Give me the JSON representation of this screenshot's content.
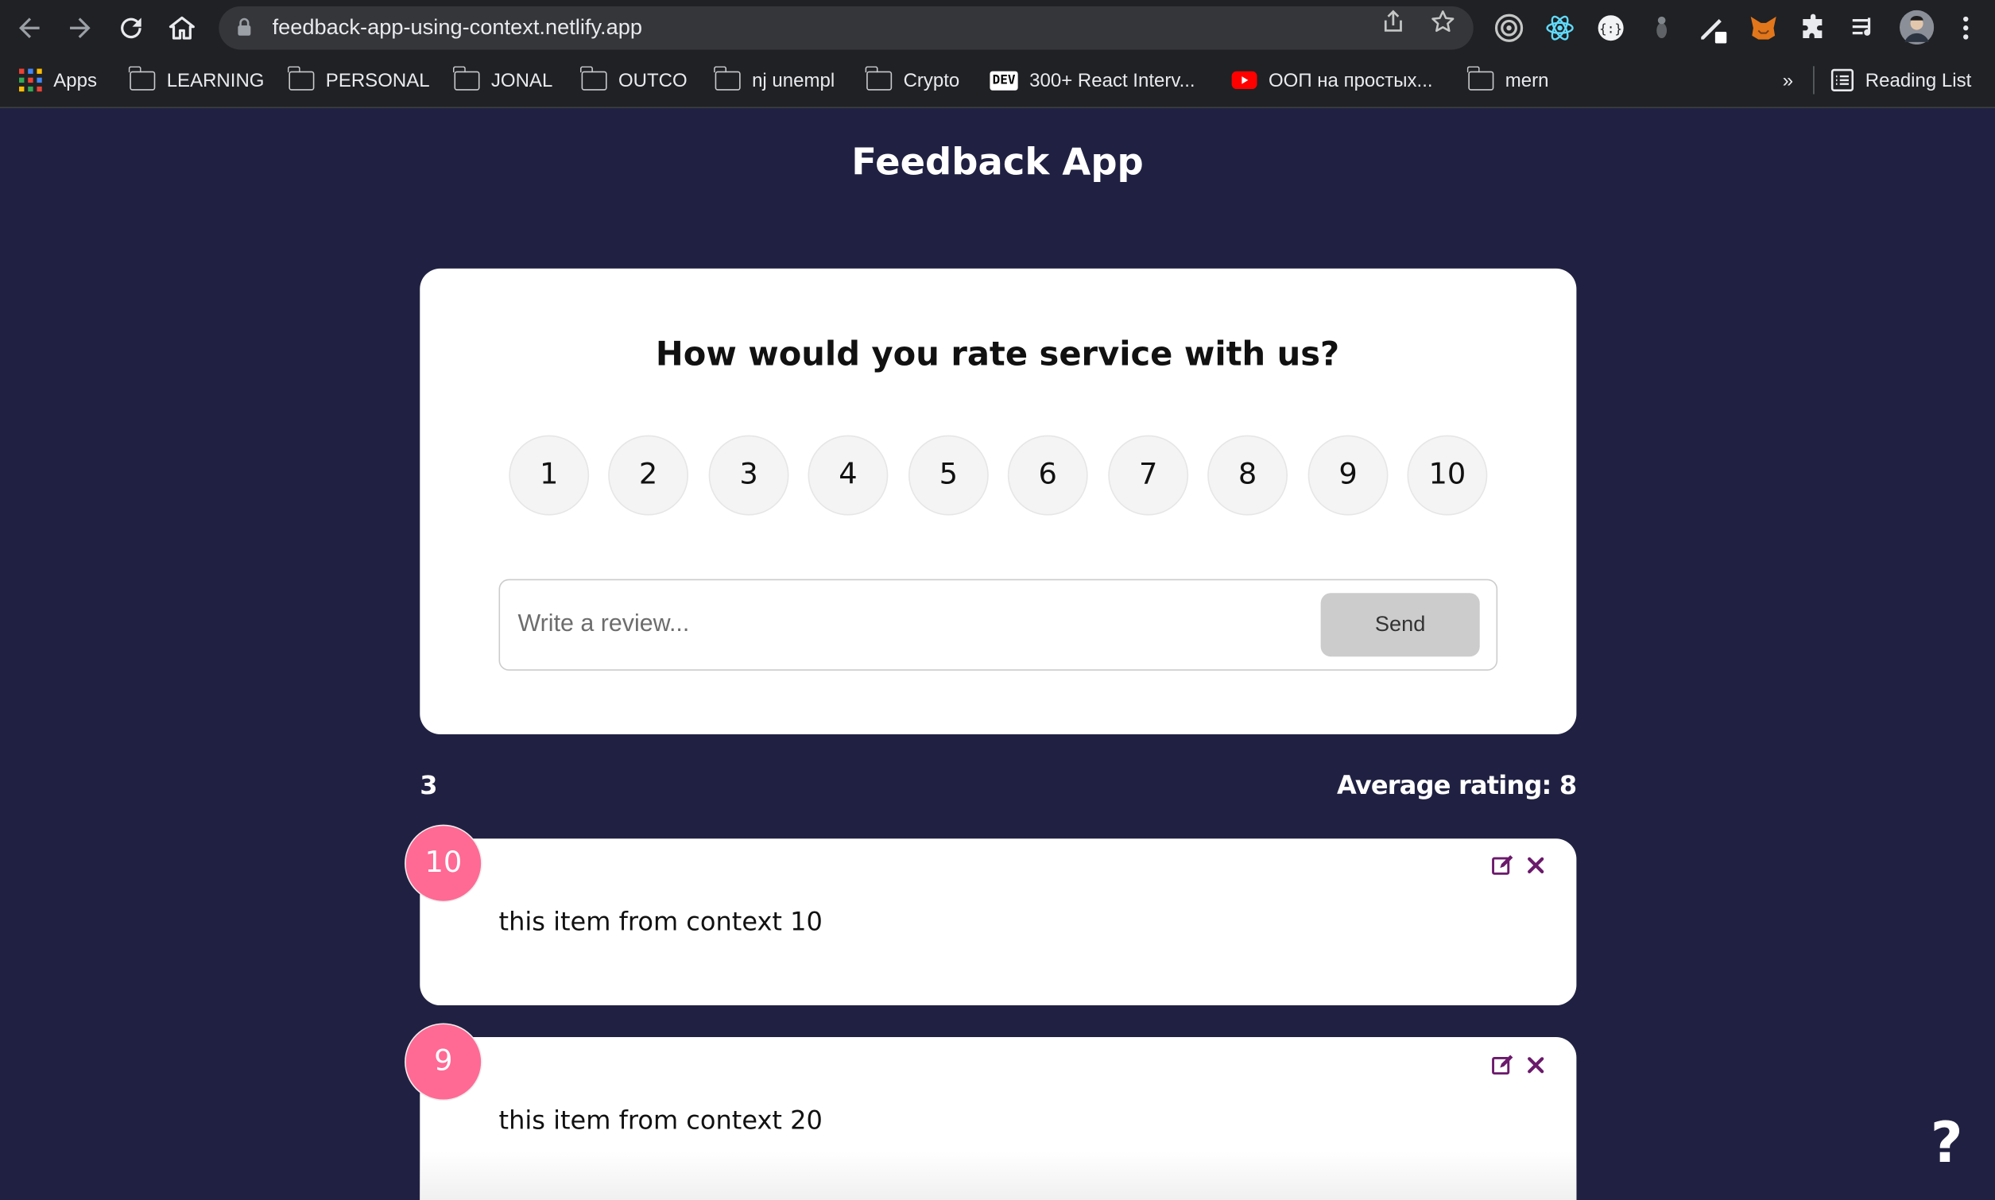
{
  "browser": {
    "url": "feedback-app-using-context.netlify.app",
    "icons": {
      "back": "arrow-left-icon",
      "forward": "arrow-right-icon",
      "reload": "reload-icon",
      "home": "home-icon",
      "share": "share-icon",
      "bookmark_star": "star-icon",
      "menu": "more-vert-icon"
    },
    "bookmarks": [
      {
        "label": "Apps",
        "icon": "apps-grid-icon"
      },
      {
        "label": "LEARNING",
        "icon": "folder-icon"
      },
      {
        "label": "PERSONAL",
        "icon": "folder-icon"
      },
      {
        "label": "JONAL",
        "icon": "folder-icon"
      },
      {
        "label": "OUTCO",
        "icon": "folder-icon"
      },
      {
        "label": "nj unempl",
        "icon": "folder-icon"
      },
      {
        "label": "Crypto",
        "icon": "folder-icon"
      },
      {
        "label": "300+ React Interv...",
        "icon": "dev-icon"
      },
      {
        "label": "ООП на простых...",
        "icon": "youtube-icon"
      },
      {
        "label": "mern",
        "icon": "folder-icon"
      }
    ],
    "overflow": "»",
    "reading_list": "Reading List",
    "dev_badge": "DEV"
  },
  "app": {
    "title": "Feedback App",
    "question": "How would you rate service with us?",
    "ratings": [
      "1",
      "2",
      "3",
      "4",
      "5",
      "6",
      "7",
      "8",
      "9",
      "10"
    ],
    "review_placeholder": "Write a review...",
    "send_label": "Send",
    "count": "3",
    "average": "Average rating: 8",
    "feedback": [
      {
        "rating": "10",
        "text": "this item from context 10"
      },
      {
        "rating": "9",
        "text": "this item from context 20"
      }
    ],
    "help": "?"
  },
  "colors": {
    "page_bg": "#202142",
    "badge": "#ff6a95",
    "action_icons": "#6b1a6b",
    "send_bg": "#cccccc"
  }
}
